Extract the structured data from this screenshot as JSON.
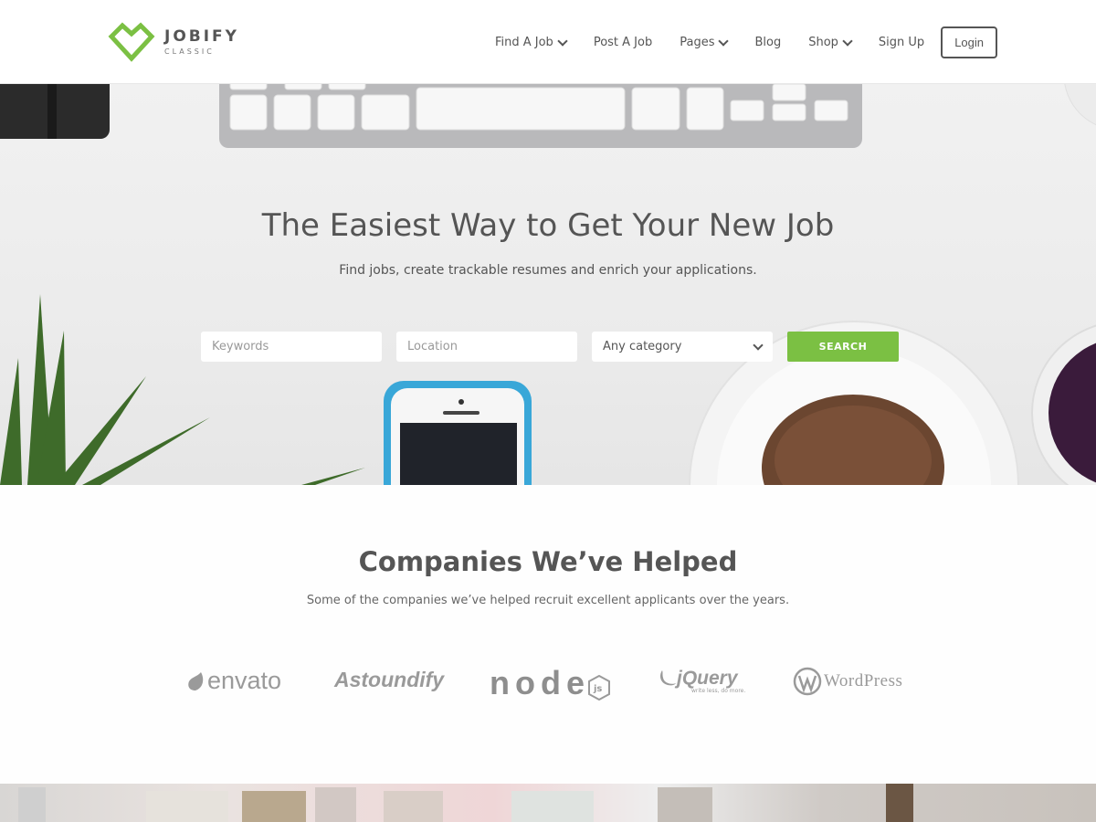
{
  "brand": {
    "name": "JOBIFY",
    "tagline": "CLASSIC",
    "accent": "#7bc043"
  },
  "nav": {
    "items": [
      {
        "label": "Find A Job",
        "dropdown": true
      },
      {
        "label": "Post A Job",
        "dropdown": false
      },
      {
        "label": "Pages",
        "dropdown": true
      },
      {
        "label": "Blog",
        "dropdown": false
      },
      {
        "label": "Shop",
        "dropdown": true
      },
      {
        "label": "Sign Up",
        "dropdown": false
      }
    ],
    "login_label": "Login"
  },
  "hero": {
    "title": "The Easiest Way to Get Your New Job",
    "subtitle": "Find jobs, create trackable resumes and enrich your applications.",
    "search": {
      "keywords_placeholder": "Keywords",
      "location_placeholder": "Location",
      "category_value": "Any category",
      "button_label": "SEARCH"
    }
  },
  "companies": {
    "title": "Companies We’ve Helped",
    "subtitle": "Some of the companies we’ve helped recruit excellent applicants over the years.",
    "logos": [
      {
        "name": "envato",
        "icon": "envato-leaf-icon"
      },
      {
        "name": "Astoundify",
        "icon": "astoundify-wordmark"
      },
      {
        "name": "node",
        "badge": "js",
        "icon": "nodejs-hexagon-icon"
      },
      {
        "name": "jQuery",
        "tagline": "write less, do more.",
        "icon": "jquery-swirl-icon"
      },
      {
        "name": "WordPress",
        "icon": "wordpress-w-icon"
      }
    ]
  }
}
